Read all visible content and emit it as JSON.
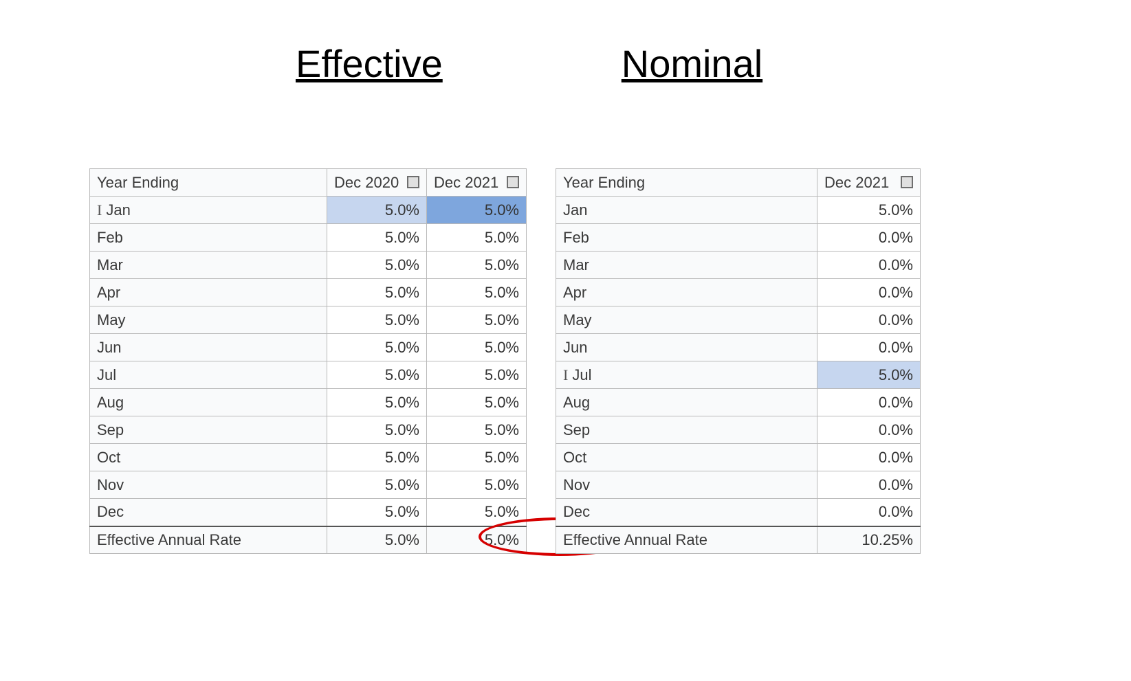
{
  "titles": {
    "effective": "Effective",
    "nominal": "Nominal"
  },
  "effective": {
    "header_label": "Year Ending",
    "columns": [
      "Dec 2020",
      "Dec 2021"
    ],
    "rows": [
      {
        "label": "Jan",
        "values": [
          "5.0%",
          "5.0%"
        ],
        "cursor": true,
        "highlight": [
          "light",
          "dark"
        ]
      },
      {
        "label": "Feb",
        "values": [
          "5.0%",
          "5.0%"
        ]
      },
      {
        "label": "Mar",
        "values": [
          "5.0%",
          "5.0%"
        ]
      },
      {
        "label": "Apr",
        "values": [
          "5.0%",
          "5.0%"
        ]
      },
      {
        "label": "May",
        "values": [
          "5.0%",
          "5.0%"
        ]
      },
      {
        "label": "Jun",
        "values": [
          "5.0%",
          "5.0%"
        ]
      },
      {
        "label": "Jul",
        "values": [
          "5.0%",
          "5.0%"
        ]
      },
      {
        "label": "Aug",
        "values": [
          "5.0%",
          "5.0%"
        ]
      },
      {
        "label": "Sep",
        "values": [
          "5.0%",
          "5.0%"
        ]
      },
      {
        "label": "Oct",
        "values": [
          "5.0%",
          "5.0%"
        ]
      },
      {
        "label": "Nov",
        "values": [
          "5.0%",
          "5.0%"
        ]
      },
      {
        "label": "Dec",
        "values": [
          "5.0%",
          "5.0%"
        ]
      }
    ],
    "footer_label": "Effective Annual Rate",
    "footer_values": [
      "5.0%",
      "5.0%"
    ]
  },
  "nominal": {
    "header_label": "Year Ending",
    "columns": [
      "Dec 2021"
    ],
    "rows": [
      {
        "label": "Jan",
        "values": [
          "5.0%"
        ]
      },
      {
        "label": "Feb",
        "values": [
          "0.0%"
        ]
      },
      {
        "label": "Mar",
        "values": [
          "0.0%"
        ]
      },
      {
        "label": "Apr",
        "values": [
          "0.0%"
        ]
      },
      {
        "label": "May",
        "values": [
          "0.0%"
        ]
      },
      {
        "label": "Jun",
        "values": [
          "0.0%"
        ]
      },
      {
        "label": "Jul",
        "values": [
          "5.0%"
        ],
        "cursor": true,
        "highlight": [
          "light"
        ]
      },
      {
        "label": "Aug",
        "values": [
          "0.0%"
        ]
      },
      {
        "label": "Sep",
        "values": [
          "0.0%"
        ]
      },
      {
        "label": "Oct",
        "values": [
          "0.0%"
        ]
      },
      {
        "label": "Nov",
        "values": [
          "0.0%"
        ]
      },
      {
        "label": "Dec",
        "values": [
          "0.0%"
        ]
      }
    ],
    "footer_label": "Effective Annual Rate",
    "footer_values": [
      "10.25%"
    ]
  }
}
